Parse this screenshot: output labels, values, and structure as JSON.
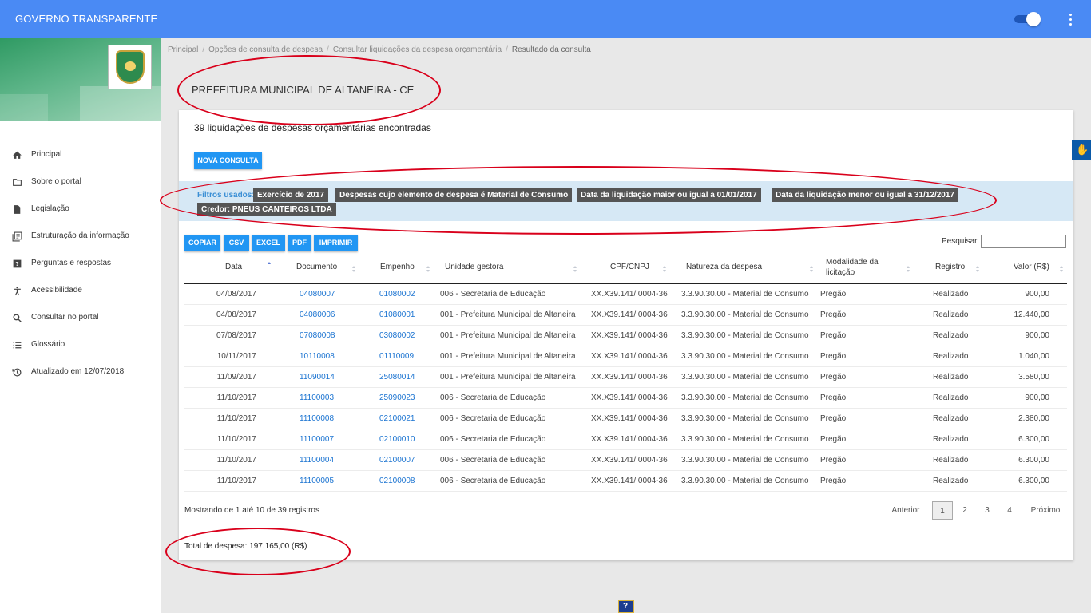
{
  "app": {
    "title": "GOVERNO TRANSPARENTE"
  },
  "sidebar": {
    "items": [
      {
        "label": "Principal",
        "icon": "home-icon"
      },
      {
        "label": "Sobre o portal",
        "icon": "folder-icon"
      },
      {
        "label": "Legislação",
        "icon": "document-icon"
      },
      {
        "label": "Estruturação da informação",
        "icon": "library-books-icon"
      },
      {
        "label": "Perguntas e respostas",
        "icon": "help-icon"
      },
      {
        "label": "Acessibilidade",
        "icon": "accessibility-icon"
      },
      {
        "label": "Consultar no portal",
        "icon": "search-icon"
      },
      {
        "label": "Glossário",
        "icon": "list-icon"
      },
      {
        "label": "Atualizado em 12/07/2018",
        "icon": "history-icon"
      }
    ]
  },
  "breadcrumb": {
    "items": [
      "Principal",
      "Opções de consulta de despesa",
      "Consultar liquidações da despesa orçamentária"
    ],
    "current": "Resultado da consulta"
  },
  "org_title": "PREFEITURA MUNICIPAL DE ALTANEIRA - CE",
  "result_count": "39 liquidações de despesas orçamentárias encontradas",
  "new_query_button": "NOVA CONSULTA",
  "filters": {
    "label": "Filtros usados:",
    "chips": [
      "Exercício de 2017",
      "Despesas cujo elemento de despesa é Material de Consumo",
      "Data da liquidação maior ou igual a 01/01/2017",
      "Data da liquidação menor ou igual a 31/12/2017",
      "Credor: PNEUS CANTEIROS LTDA"
    ]
  },
  "export_buttons": [
    "COPIAR",
    "CSV",
    "EXCEL",
    "PDF",
    "IMPRIMIR"
  ],
  "search": {
    "label": "Pesquisar",
    "value": ""
  },
  "table": {
    "columns": [
      "Data",
      "Documento",
      "Empenho",
      "Unidade gestora",
      "CPF/CNPJ",
      "Natureza da despesa",
      "Modalidade da licitação",
      "Registro",
      "Valor (R$)"
    ],
    "rows": [
      [
        "04/08/2017",
        "04080007",
        "01080002",
        "006 - Secretaria de Educação",
        "XX.X39.141/ 0004-36",
        "3.3.90.30.00 - Material de Consumo",
        "Pregão",
        "Realizado",
        "900,00"
      ],
      [
        "04/08/2017",
        "04080006",
        "01080001",
        "001 - Prefeitura Municipal de Altaneira",
        "XX.X39.141/ 0004-36",
        "3.3.90.30.00 - Material de Consumo",
        "Pregão",
        "Realizado",
        "12.440,00"
      ],
      [
        "07/08/2017",
        "07080008",
        "03080002",
        "001 - Prefeitura Municipal de Altaneira",
        "XX.X39.141/ 0004-36",
        "3.3.90.30.00 - Material de Consumo",
        "Pregão",
        "Realizado",
        "900,00"
      ],
      [
        "10/11/2017",
        "10110008",
        "01110009",
        "001 - Prefeitura Municipal de Altaneira",
        "XX.X39.141/ 0004-36",
        "3.3.90.30.00 - Material de Consumo",
        "Pregão",
        "Realizado",
        "1.040,00"
      ],
      [
        "11/09/2017",
        "11090014",
        "25080014",
        "001 - Prefeitura Municipal de Altaneira",
        "XX.X39.141/ 0004-36",
        "3.3.90.30.00 - Material de Consumo",
        "Pregão",
        "Realizado",
        "3.580,00"
      ],
      [
        "11/10/2017",
        "11100003",
        "25090023",
        "006 - Secretaria de Educação",
        "XX.X39.141/ 0004-36",
        "3.3.90.30.00 - Material de Consumo",
        "Pregão",
        "Realizado",
        "900,00"
      ],
      [
        "11/10/2017",
        "11100008",
        "02100021",
        "006 - Secretaria de Educação",
        "XX.X39.141/ 0004-36",
        "3.3.90.30.00 - Material de Consumo",
        "Pregão",
        "Realizado",
        "2.380,00"
      ],
      [
        "11/10/2017",
        "11100007",
        "02100010",
        "006 - Secretaria de Educação",
        "XX.X39.141/ 0004-36",
        "3.3.90.30.00 - Material de Consumo",
        "Pregão",
        "Realizado",
        "6.300,00"
      ],
      [
        "11/10/2017",
        "11100004",
        "02100007",
        "006 - Secretaria de Educação",
        "XX.X39.141/ 0004-36",
        "3.3.90.30.00 - Material de Consumo",
        "Pregão",
        "Realizado",
        "6.300,00"
      ],
      [
        "11/10/2017",
        "11100005",
        "02100008",
        "006 - Secretaria de Educação",
        "XX.X39.141/ 0004-36",
        "3.3.90.30.00 - Material de Consumo",
        "Pregão",
        "Realizado",
        "6.300,00"
      ]
    ]
  },
  "showing": "Mostrando de 1 até 10 de 39 registros",
  "pagination": {
    "prev": "Anterior",
    "pages": [
      "1",
      "2",
      "3",
      "4"
    ],
    "current": "1",
    "next": "Próximo"
  },
  "total": "Total de despesa: 197.165,00 (R$)",
  "colors": {
    "topbar": "#4a8af4",
    "button": "#2196f3",
    "link": "#1a73d1",
    "annotation": "#d9001b",
    "filter_bg": "#d6e8f5"
  }
}
